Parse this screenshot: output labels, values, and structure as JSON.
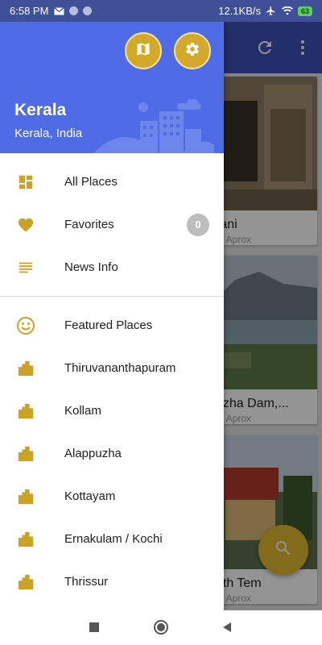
{
  "status_bar": {
    "time": "6:58 PM",
    "network_speed": "12.1KB/s",
    "battery": "63"
  },
  "drawer": {
    "header": {
      "title": "Kerala",
      "subtitle": "Kerala, India"
    },
    "items": [
      {
        "label": "All Places",
        "icon": "grid-icon"
      },
      {
        "label": "Favorites",
        "icon": "heart-icon",
        "badge": "0"
      },
      {
        "label": "News Info",
        "icon": "list-icon"
      }
    ],
    "places": [
      {
        "label": "Featured Places",
        "icon": "smiley-icon"
      },
      {
        "label": "Thiruvananthapuram",
        "icon": "city-icon"
      },
      {
        "label": "Kollam",
        "icon": "city-icon"
      },
      {
        "label": "Alappuzha",
        "icon": "city-icon"
      },
      {
        "label": "Kottayam",
        "icon": "city-icon"
      },
      {
        "label": "Ernakulam / Kochi",
        "icon": "city-icon"
      },
      {
        "label": "Thrissur",
        "icon": "city-icon"
      }
    ]
  },
  "background_cards": [
    {
      "title": "rani",
      "sub": "m Aprox"
    },
    {
      "title": "uzha Dam,...",
      "sub": "m Aprox"
    },
    {
      "title": "ath Tem",
      "sub": "m Aprox"
    }
  ],
  "colors": {
    "accent": "#d4a92a",
    "header": "#4f6be6",
    "toolbar": "#3f51b5"
  }
}
